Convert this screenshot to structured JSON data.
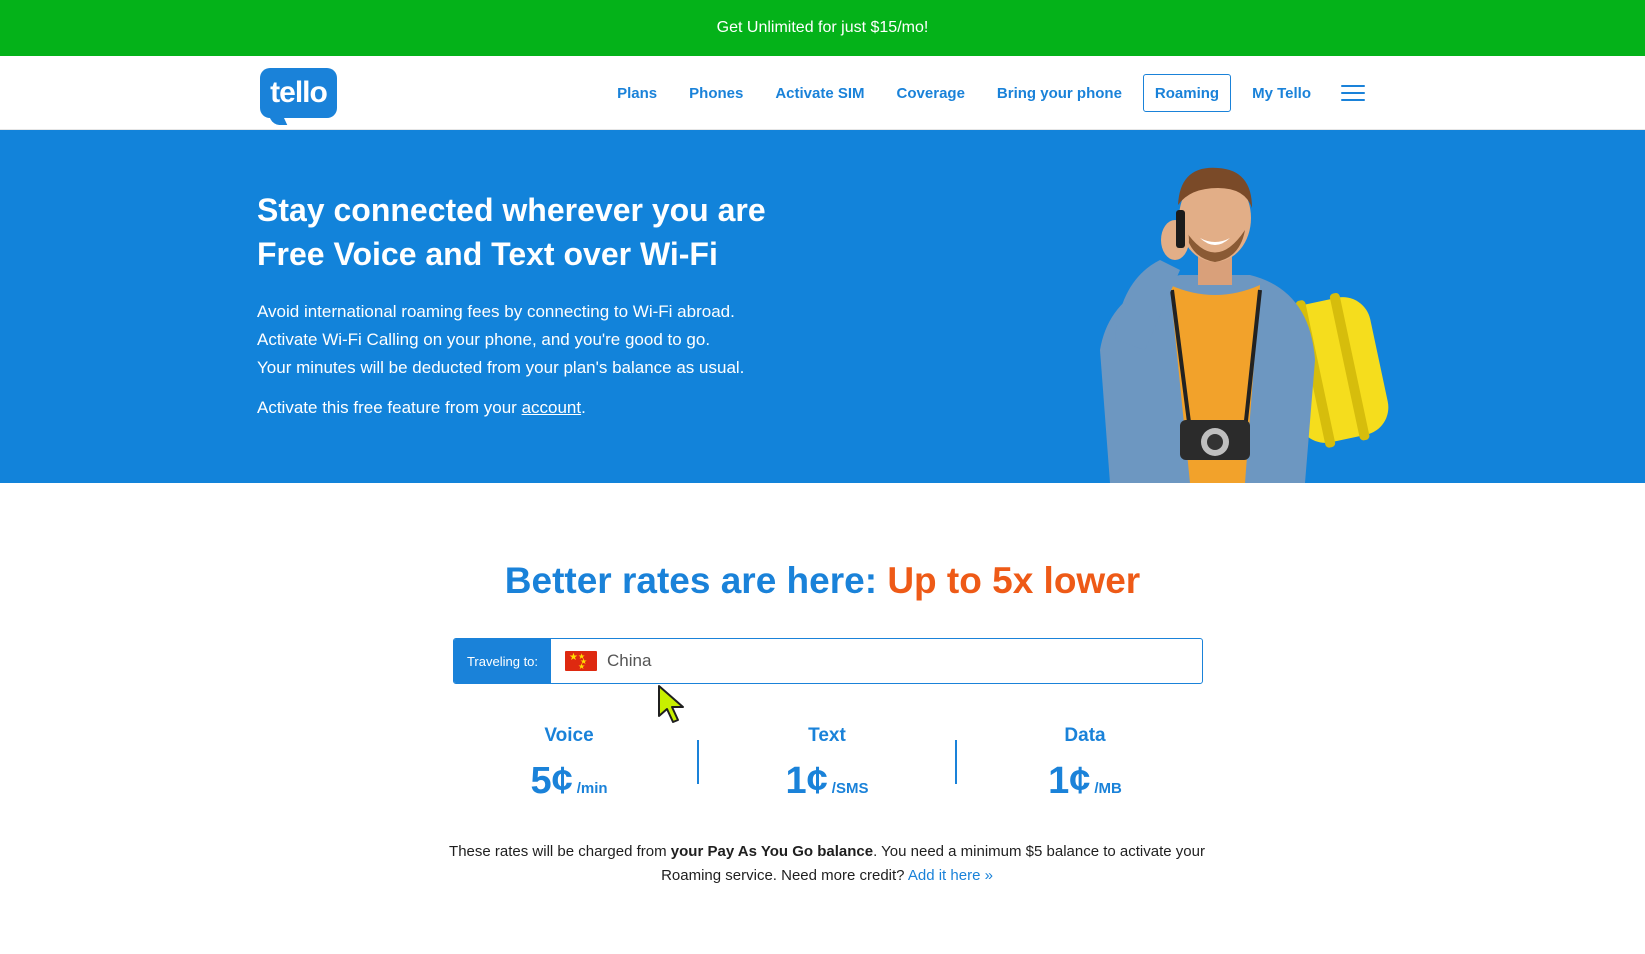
{
  "promo": {
    "text": "Get Unlimited for just $15/mo!"
  },
  "header": {
    "logo_text": "tello",
    "nav": [
      {
        "label": "Plans"
      },
      {
        "label": "Phones"
      },
      {
        "label": "Activate SIM"
      },
      {
        "label": "Coverage"
      },
      {
        "label": "Bring your phone"
      },
      {
        "label": "Roaming",
        "active": true
      },
      {
        "label": "My Tello"
      }
    ],
    "menu_icon": "hamburger-menu-icon"
  },
  "hero": {
    "title_line1": "Stay connected wherever you are",
    "title_line2": "Free Voice and Text over Wi-Fi",
    "body_line1": "Avoid international roaming fees by connecting to Wi-Fi abroad.",
    "body_line2": "Activate Wi-Fi Calling on your phone, and you're good to go.",
    "body_line3": "Your minutes will be deducted from your plan's balance as usual.",
    "cta_prefix": "Activate this free feature from your ",
    "cta_link": "account",
    "cta_suffix": "."
  },
  "rates": {
    "heading_main": "Better rates are here: ",
    "heading_accent": "Up to 5x lower",
    "destination_label": "Traveling to:",
    "destination_value": "China",
    "destination_flag": "china-flag-icon",
    "columns": [
      {
        "label": "Voice",
        "amount": "5¢",
        "unit": "/min"
      },
      {
        "label": "Text",
        "amount": "1¢",
        "unit": "/SMS"
      },
      {
        "label": "Data",
        "amount": "1¢",
        "unit": "/MB"
      }
    ],
    "note_prefix": "These rates will be charged from ",
    "note_bold": "your Pay As You Go balance",
    "note_middle": ". You need a minimum $5 balance to activate your Roaming service. Need more credit? ",
    "note_link": "Add it here »"
  },
  "colors": {
    "promo_green": "#04b219",
    "brand_blue": "#1a82d9",
    "hero_blue": "#1283da",
    "accent_orange": "#ee5a17"
  }
}
